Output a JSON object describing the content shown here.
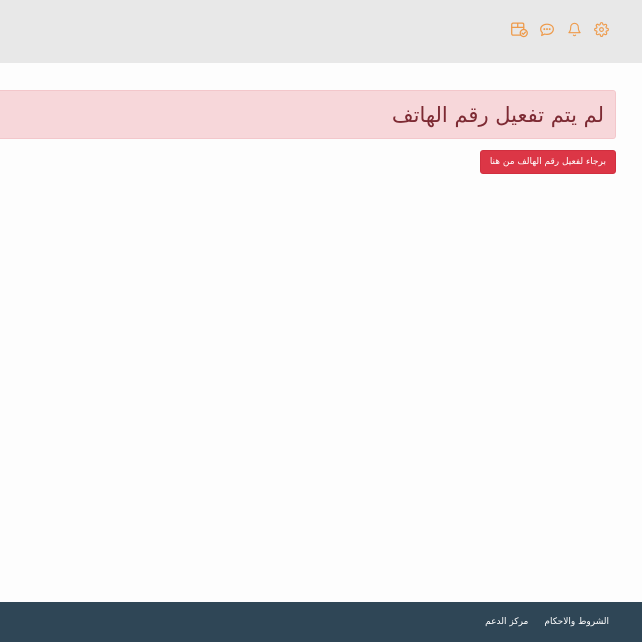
{
  "header": {
    "icons": [
      "gear-icon",
      "bell-icon",
      "chat-icon",
      "box-check-icon"
    ],
    "icon_color": "#ee9a4a",
    "background": "#e8e8e8"
  },
  "alert": {
    "text": "لم يتم تفعيل رقم الهاتف",
    "background": "#f7d7da",
    "text_color": "#7d2a33"
  },
  "activate_button": {
    "label": "برجاء لفعيل رقم الهالف من هنا",
    "background": "#dc3646"
  },
  "footer": {
    "links": [
      "مركز الدعم",
      "الشروط والاحكام"
    ],
    "background": "#2f4656"
  }
}
